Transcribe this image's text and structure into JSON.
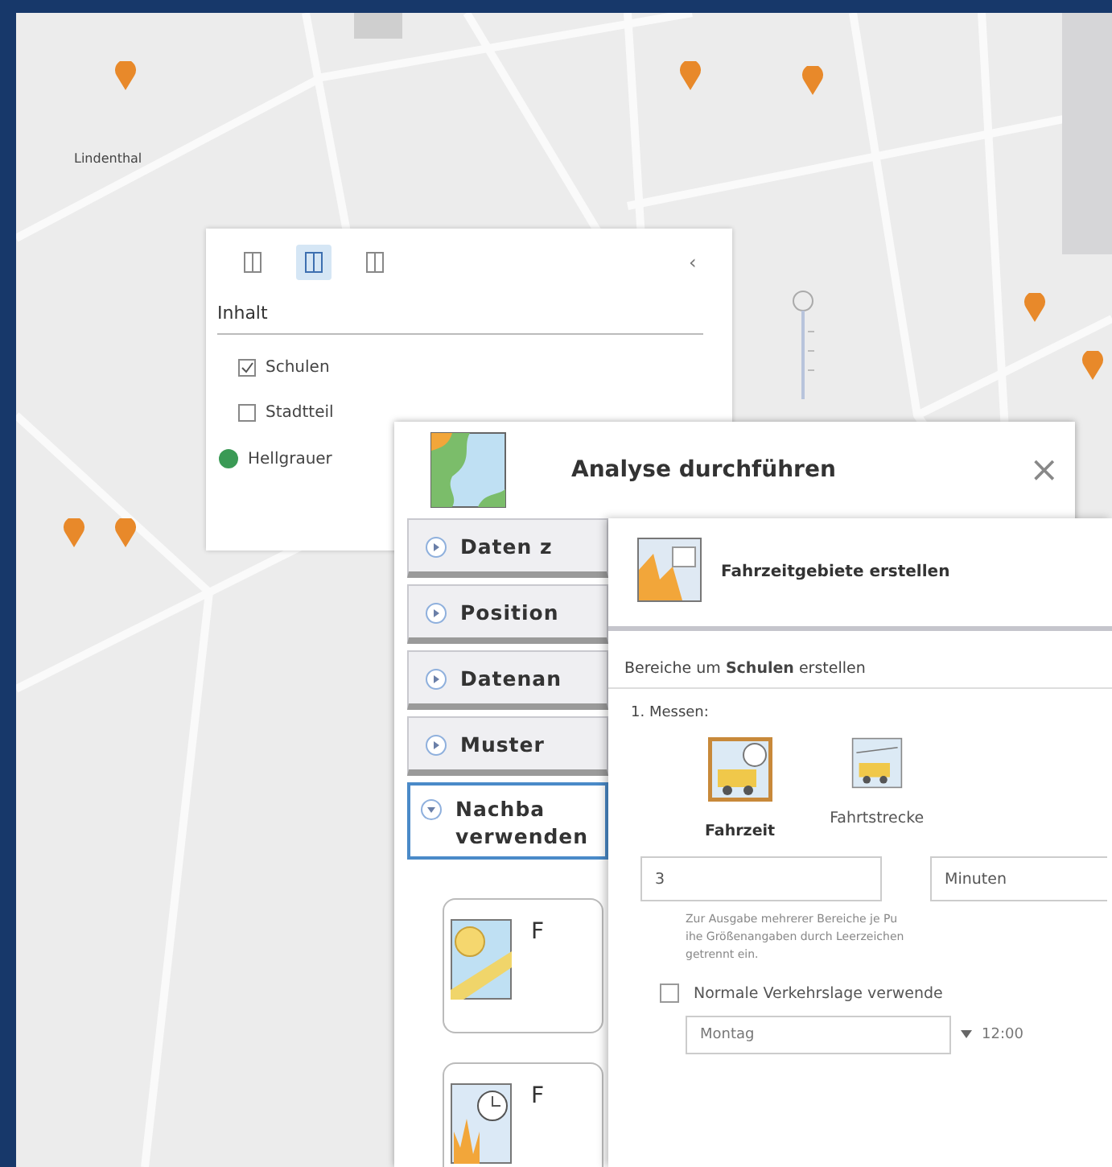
{
  "map": {
    "place_label": "Lindenthal"
  },
  "layer_panel": {
    "tabs": [
      {
        "selected": false
      },
      {
        "selected": true
      },
      {
        "selected": false
      }
    ],
    "collapse": "‹",
    "title": "Inhalt",
    "layers": [
      {
        "name": "Schulen",
        "kind": "checkbox",
        "checked": true
      },
      {
        "name": "Stadtteil",
        "kind": "checkbox",
        "checked": false
      },
      {
        "name": "Hellgrauer",
        "kind": "basemap"
      }
    ]
  },
  "analysis_panel": {
    "title": "Analyse durchführen",
    "close": "×",
    "sections": [
      {
        "label": "Daten z",
        "expanded": false
      },
      {
        "label": "Position",
        "expanded": false
      },
      {
        "label": "Datenan",
        "expanded": false
      },
      {
        "label": "Muster",
        "expanded": false
      },
      {
        "label": "Nachba verwenden",
        "expanded": true
      }
    ],
    "tools": [
      {
        "label": "F",
        "kind": "buffer"
      },
      {
        "label": "F",
        "kind": "time"
      }
    ]
  },
  "drive_panel": {
    "title": "Fahrzeitgebiete erstellen",
    "description": "Bereiche um **Schulen** erstellen",
    "step": "1. Messen:",
    "modes": [
      {
        "label": "Fahrzeit",
        "selected": true
      },
      {
        "label": "Fahrtstrecke",
        "selected": false
      }
    ],
    "value": "3",
    "unit": "Minuten",
    "hint": "Zur Ausgabe mehrerer Bereiche je Pu\nihe Größenangaben durch Leerzeichen\ngetrennt ein.",
    "traffic": {
      "label": "Normale Verkehrslage verwende",
      "checked": false
    },
    "day": "Montag",
    "time": "12:00"
  }
}
